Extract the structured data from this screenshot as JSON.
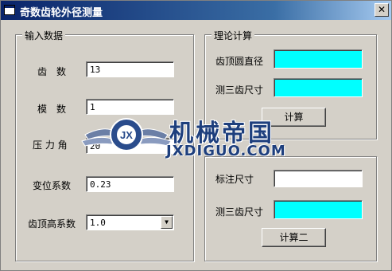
{
  "window": {
    "title": "奇数齿轮外径测量",
    "close_glyph": "✕"
  },
  "input_group": {
    "title": "输入数据",
    "teeth": {
      "label": "齿　数",
      "value": "13"
    },
    "module": {
      "label": "模　数",
      "value": "1"
    },
    "pressure_angle": {
      "label": "压 力 角",
      "value": "20"
    },
    "shift_coeff": {
      "label": "变位系数",
      "value": "0.23"
    },
    "addendum_coeff": {
      "label": "齿顶高系数",
      "value": "1.0"
    }
  },
  "theory_group": {
    "title": "理论计算",
    "tip_diameter": {
      "label": "齿顶圆直径",
      "value": ""
    },
    "three_teeth": {
      "label": "测三齿尺寸",
      "value": ""
    },
    "calc_button": "计算"
  },
  "measure_group": {
    "marked_size": {
      "label": "标注尺寸",
      "value": ""
    },
    "three_teeth": {
      "label": "测三齿尺寸",
      "value": ""
    },
    "calc_button": "计算二"
  },
  "watermark": {
    "text": "机械帝国",
    "subtext": "JXDIGUO.COM",
    "badge": "JX"
  },
  "colors": {
    "result_field": "#00ffff",
    "titlebar": "#0a246a"
  }
}
